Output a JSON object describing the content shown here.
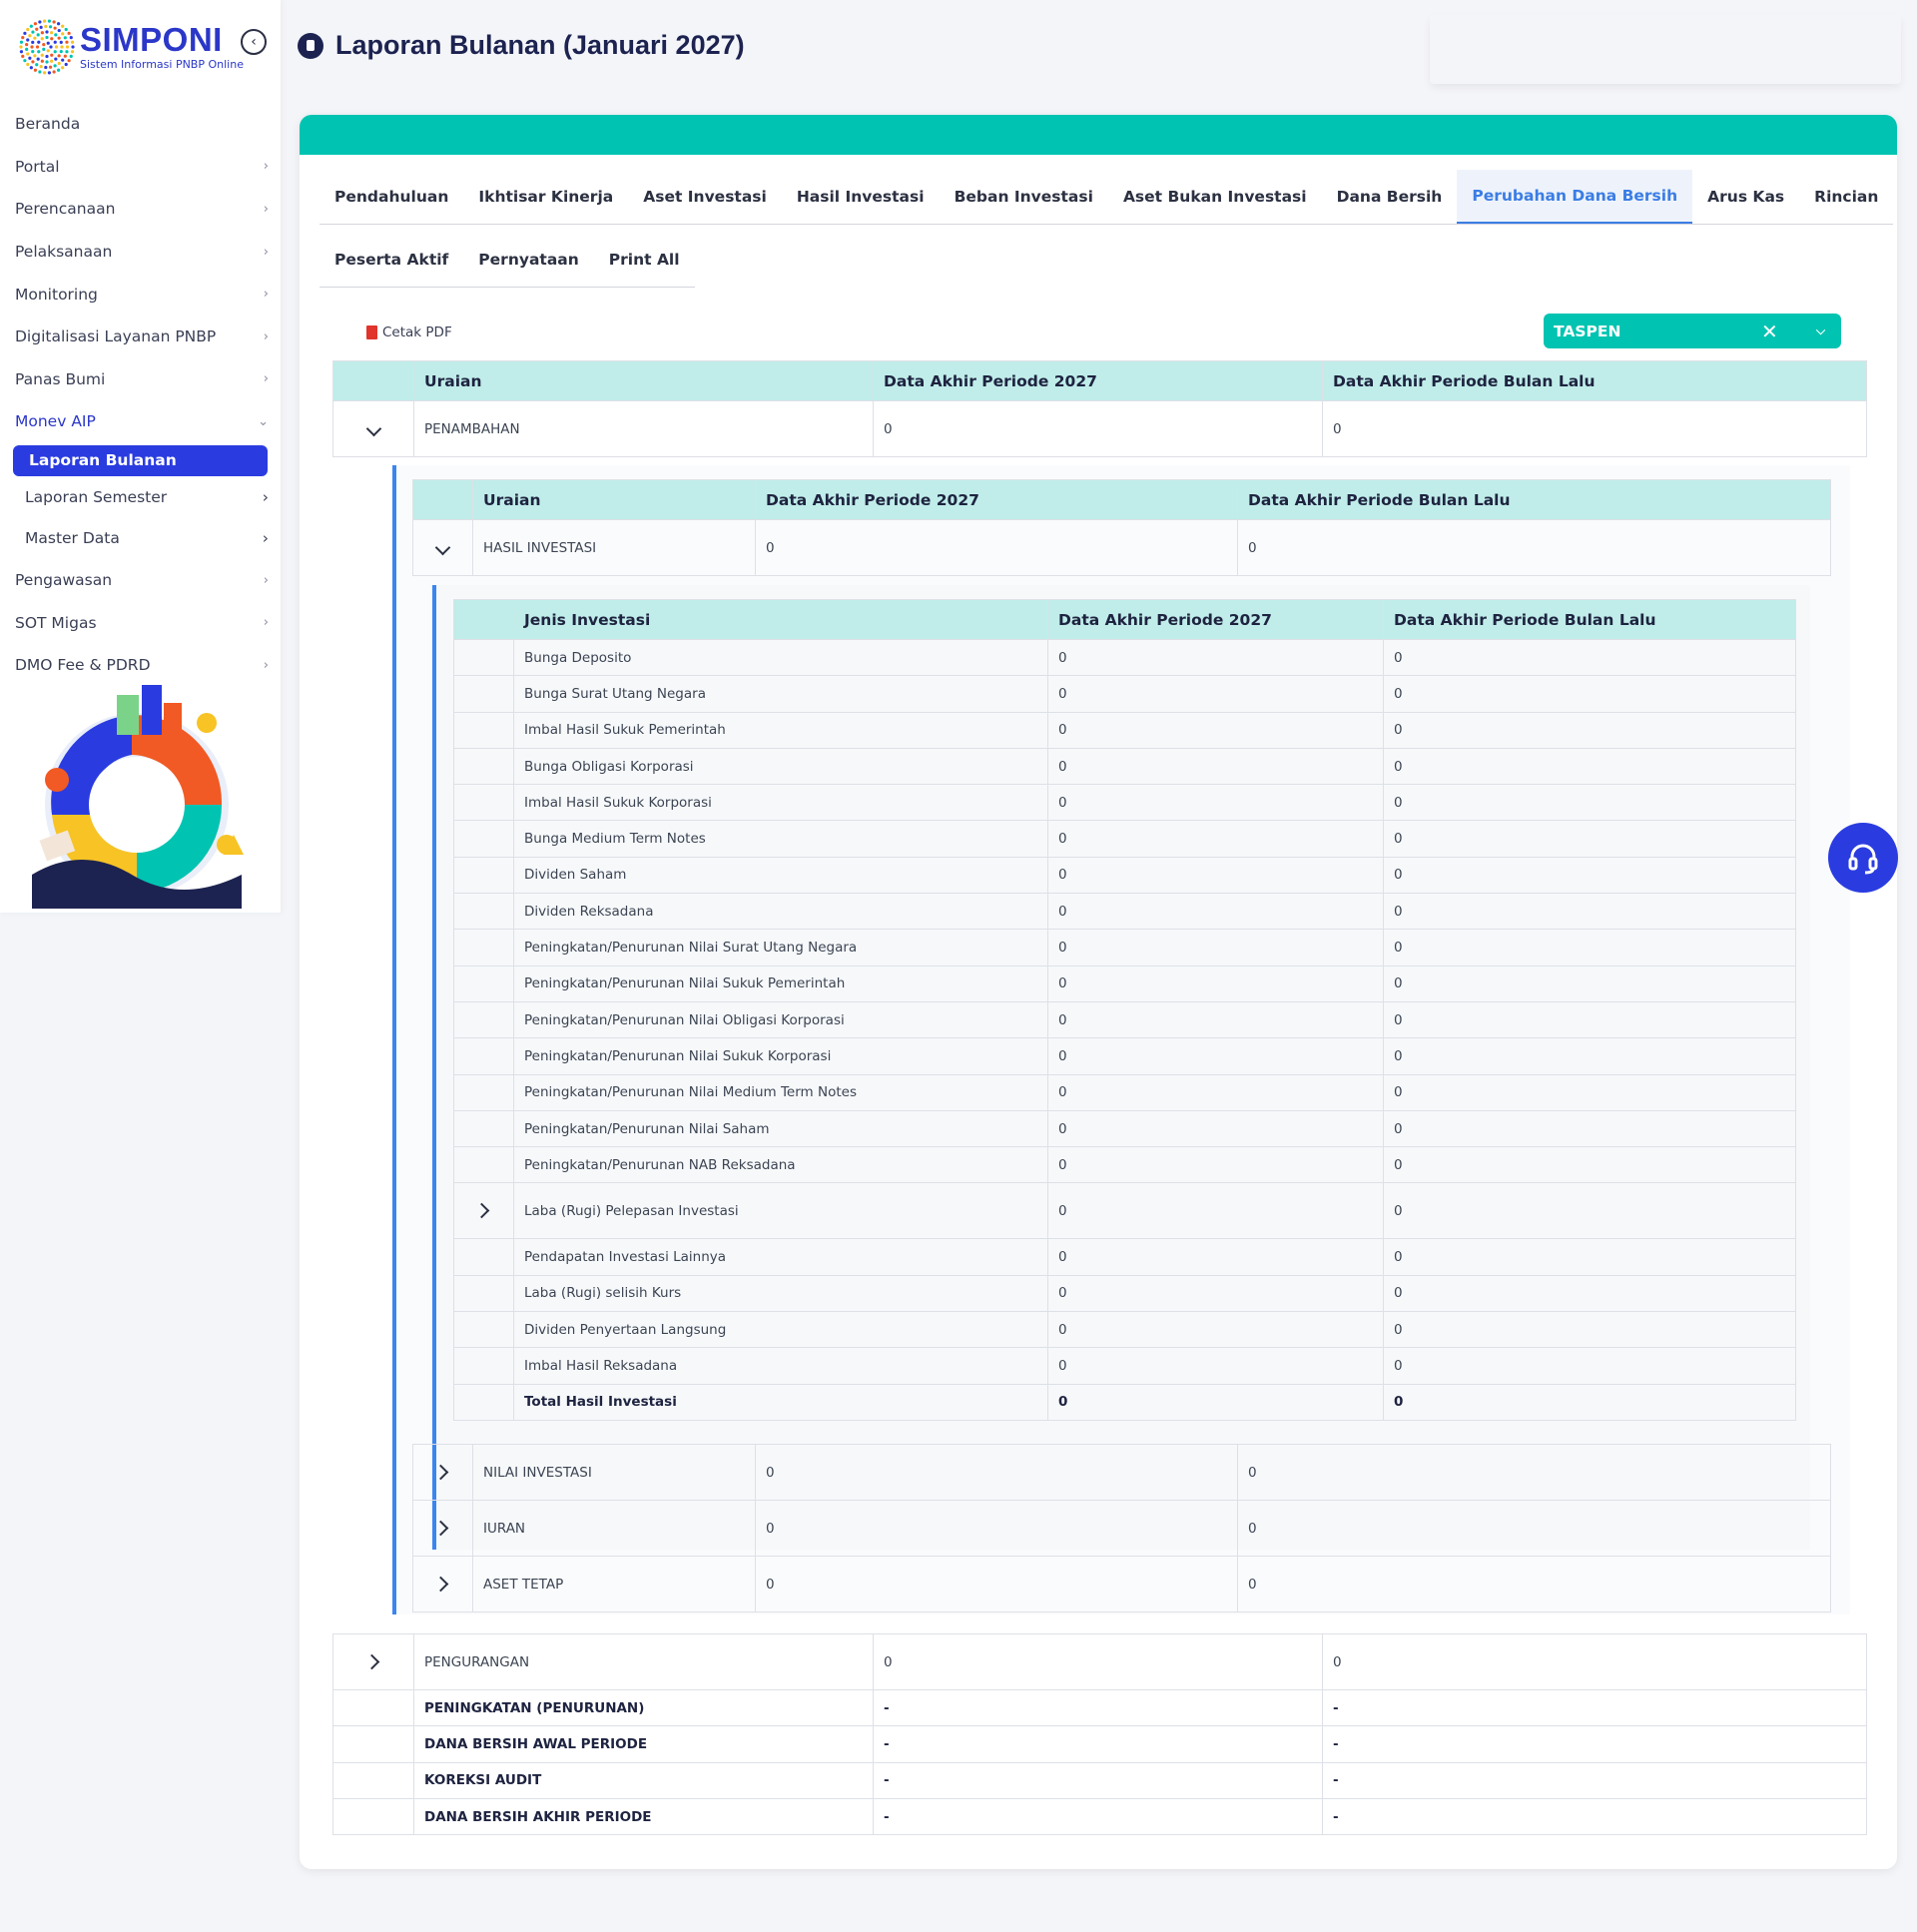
{
  "app": {
    "logo_title": "SIMPONI",
    "logo_subtitle": "Sistem Informasi PNBP Online",
    "page_title": "Laporan Bulanan (Januari 2027)"
  },
  "sidebar": {
    "items": [
      {
        "label": "Beranda"
      },
      {
        "label": "Portal"
      },
      {
        "label": "Perencanaan"
      },
      {
        "label": "Pelaksanaan"
      },
      {
        "label": "Monitoring"
      },
      {
        "label": "Digitalisasi Layanan PNBP"
      },
      {
        "label": "Panas Bumi"
      },
      {
        "label": "Monev AIP"
      }
    ],
    "sub_items": [
      {
        "label": "Laporan Bulanan"
      },
      {
        "label": "Laporan Semester"
      },
      {
        "label": "Master Data"
      }
    ],
    "items_after": [
      {
        "label": "Pengawasan"
      },
      {
        "label": "SOT Migas"
      },
      {
        "label": "DMO Fee & PDRD"
      }
    ]
  },
  "tabs_row1": [
    "Pendahuluan",
    "Ikhtisar Kinerja",
    "Aset Investasi",
    "Hasil Investasi",
    "Beban Investasi",
    "Aset Bukan Investasi",
    "Dana Bersih",
    "Perubahan Dana Bersih",
    "Arus Kas",
    "Rincian"
  ],
  "tabs_row2": [
    "Peserta Aktif",
    "Pernyataan",
    "Print All"
  ],
  "toolbar": {
    "pdf_label": "Cetak PDF",
    "select_value": "TASPEN"
  },
  "headers": {
    "uraian": "Uraian",
    "jenis": "Jenis Investasi",
    "col_2027": "Data Akhir Periode 2027",
    "col_prev": "Data Akhir Periode Bulan Lalu"
  },
  "outer": {
    "penambahan": {
      "label": "PENAMBAHAN",
      "v1": "0",
      "v2": "0"
    },
    "pengurangan": {
      "label": "PENGURANGAN",
      "v1": "0",
      "v2": "0"
    },
    "summary": [
      {
        "label": "PENINGKATAN (PENURUNAN)",
        "v1": "-",
        "v2": "-"
      },
      {
        "label": "DANA BERSIH AWAL PERIODE",
        "v1": "-",
        "v2": "-"
      },
      {
        "label": "KOREKSI AUDIT",
        "v1": "-",
        "v2": "-"
      },
      {
        "label": "DANA BERSIH AKHIR PERIODE",
        "v1": "-",
        "v2": "-"
      }
    ]
  },
  "level2": {
    "hasil": {
      "label": "HASIL INVESTASI",
      "v1": "0",
      "v2": "0"
    },
    "others": [
      {
        "label": "NILAI INVESTASI",
        "v1": "0",
        "v2": "0"
      },
      {
        "label": "IURAN",
        "v1": "0",
        "v2": "0"
      },
      {
        "label": "ASET TETAP",
        "v1": "0",
        "v2": "0"
      }
    ]
  },
  "level3": [
    {
      "label": "Bunga Deposito",
      "v1": "0",
      "v2": "0"
    },
    {
      "label": "Bunga Surat Utang Negara",
      "v1": "0",
      "v2": "0"
    },
    {
      "label": "Imbal Hasil Sukuk Pemerintah",
      "v1": "0",
      "v2": "0"
    },
    {
      "label": "Bunga Obligasi Korporasi",
      "v1": "0",
      "v2": "0"
    },
    {
      "label": "Imbal Hasil Sukuk Korporasi",
      "v1": "0",
      "v2": "0"
    },
    {
      "label": "Bunga Medium Term Notes",
      "v1": "0",
      "v2": "0"
    },
    {
      "label": "Dividen Saham",
      "v1": "0",
      "v2": "0"
    },
    {
      "label": "Dividen Reksadana",
      "v1": "0",
      "v2": "0"
    },
    {
      "label": "Peningkatan/Penurunan Nilai Surat Utang Negara",
      "v1": "0",
      "v2": "0"
    },
    {
      "label": "Peningkatan/Penurunan Nilai Sukuk Pemerintah",
      "v1": "0",
      "v2": "0"
    },
    {
      "label": "Peningkatan/Penurunan Nilai Obligasi Korporasi",
      "v1": "0",
      "v2": "0"
    },
    {
      "label": "Peningkatan/Penurunan Nilai Sukuk Korporasi",
      "v1": "0",
      "v2": "0"
    },
    {
      "label": "Peningkatan/Penurunan Nilai Medium Term Notes",
      "v1": "0",
      "v2": "0"
    },
    {
      "label": "Peningkatan/Penurunan Nilai Saham",
      "v1": "0",
      "v2": "0"
    },
    {
      "label": "Peningkatan/Penurunan NAB Reksadana",
      "v1": "0",
      "v2": "0"
    },
    {
      "label": "Laba (Rugi) Pelepasan Investasi",
      "v1": "0",
      "v2": "0",
      "expandable": true
    },
    {
      "label": "Pendapatan Investasi Lainnya",
      "v1": "0",
      "v2": "0"
    },
    {
      "label": "Laba (Rugi) selisih Kurs",
      "v1": "0",
      "v2": "0"
    },
    {
      "label": "Dividen Penyertaan Langsung",
      "v1": "0",
      "v2": "0"
    },
    {
      "label": "Imbal Hasil Reksadana",
      "v1": "0",
      "v2": "0"
    },
    {
      "label": "Total Hasil Investasi",
      "v1": "0",
      "v2": "0",
      "total": true
    }
  ],
  "colors": {
    "accent": "#2a3ce0",
    "teal": "#00c4b1",
    "header_bg": "#c0ede9",
    "nest_bar": "#3b86ee"
  }
}
